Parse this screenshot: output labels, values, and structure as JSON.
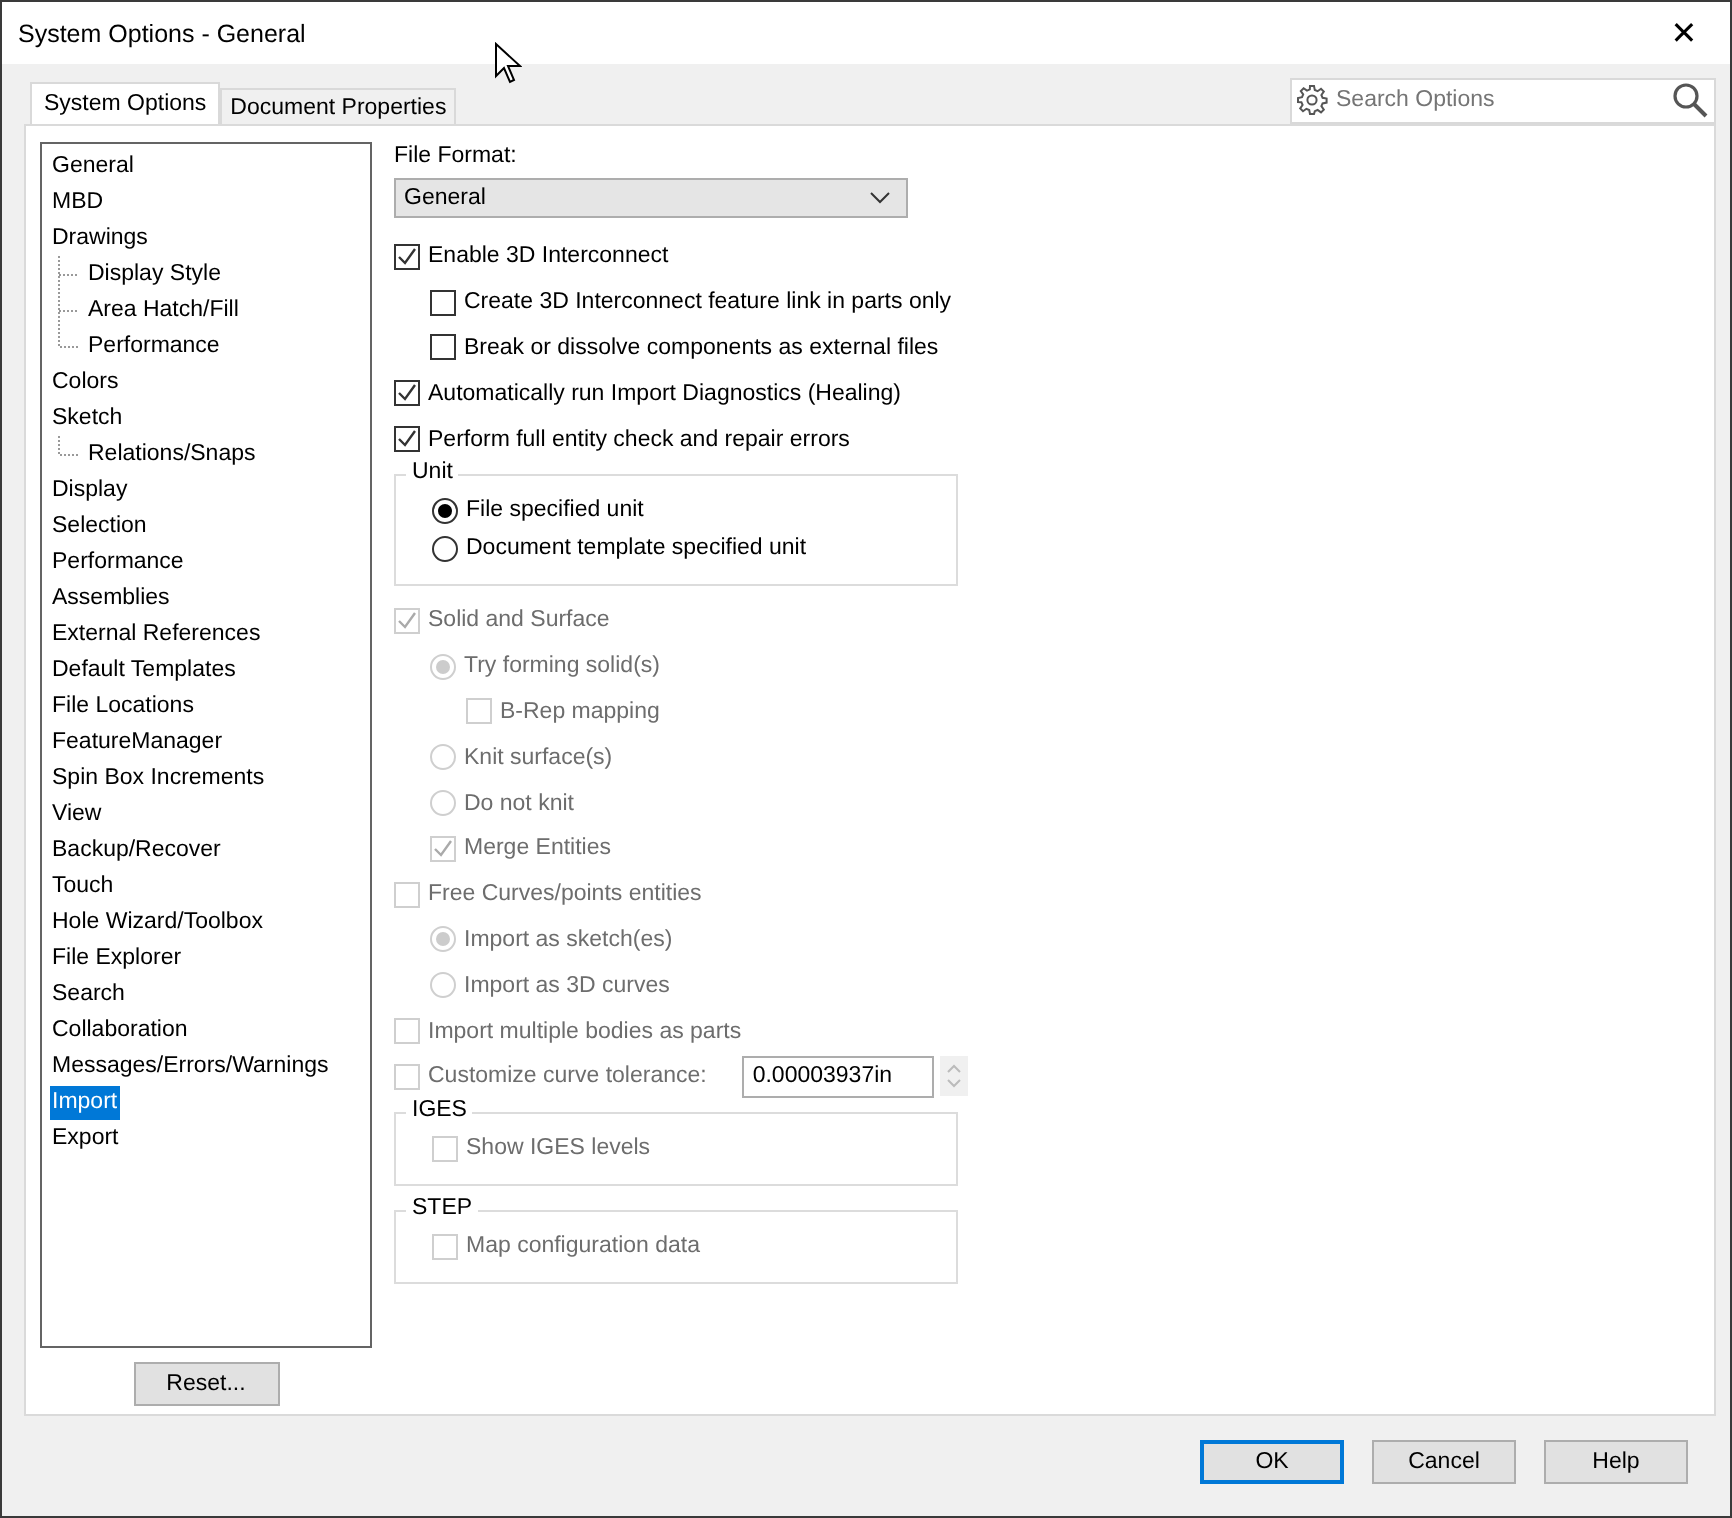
{
  "window": {
    "title": "System Options - General",
    "close": "✕"
  },
  "tabs": [
    {
      "label": "System Options",
      "selected": true
    },
    {
      "label": "Document Properties",
      "selected": false
    }
  ],
  "search": {
    "placeholder": "Search Options"
  },
  "sidebar": {
    "items": [
      {
        "label": "General",
        "selected": false
      },
      {
        "label": "MBD",
        "selected": false
      },
      {
        "label": "Drawings",
        "selected": false,
        "children": [
          {
            "label": "Display Style",
            "selected": false
          },
          {
            "label": "Area Hatch/Fill",
            "selected": false
          },
          {
            "label": "Performance",
            "selected": false
          }
        ]
      },
      {
        "label": "Colors",
        "selected": false
      },
      {
        "label": "Sketch",
        "selected": false,
        "children": [
          {
            "label": "Relations/Snaps",
            "selected": false
          }
        ]
      },
      {
        "label": "Display",
        "selected": false
      },
      {
        "label": "Selection",
        "selected": false
      },
      {
        "label": "Performance",
        "selected": false
      },
      {
        "label": "Assemblies",
        "selected": false
      },
      {
        "label": "External References",
        "selected": false
      },
      {
        "label": "Default Templates",
        "selected": false
      },
      {
        "label": "File Locations",
        "selected": false
      },
      {
        "label": "FeatureManager",
        "selected": false
      },
      {
        "label": "Spin Box Increments",
        "selected": false
      },
      {
        "label": "View",
        "selected": false
      },
      {
        "label": "Backup/Recover",
        "selected": false
      },
      {
        "label": "Touch",
        "selected": false
      },
      {
        "label": "Hole Wizard/Toolbox",
        "selected": false
      },
      {
        "label": "File Explorer",
        "selected": false
      },
      {
        "label": "Search",
        "selected": false
      },
      {
        "label": "Collaboration",
        "selected": false
      },
      {
        "label": "Messages/Errors/Warnings",
        "selected": false
      },
      {
        "label": "Import",
        "selected": true
      },
      {
        "label": "Export",
        "selected": false
      }
    ],
    "reset_button": "Reset..."
  },
  "file_format": {
    "label": "File Format:",
    "value": "General"
  },
  "options": [
    {
      "kind": "checkbox",
      "label": "Enable 3D Interconnect",
      "checked": true,
      "disabled": false,
      "children": [
        {
          "kind": "checkbox",
          "label": "Create 3D Interconnect feature link in parts only",
          "checked": false,
          "disabled": false
        },
        {
          "kind": "checkbox",
          "label": "Break or dissolve components as external files",
          "checked": false,
          "disabled": false
        }
      ]
    },
    {
      "kind": "checkbox",
      "label": "Automatically run Import Diagnostics (Healing)",
      "checked": true,
      "disabled": false
    },
    {
      "kind": "checkbox",
      "label": "Perform full entity check and repair errors",
      "checked": true,
      "disabled": false
    },
    {
      "kind": "group",
      "label": "Unit",
      "children": [
        {
          "kind": "radio",
          "label": "File specified unit",
          "selected": true,
          "disabled": false
        },
        {
          "kind": "radio",
          "label": "Document template specified unit",
          "selected": false,
          "disabled": false
        }
      ]
    },
    {
      "kind": "checkbox",
      "label": "Solid and Surface",
      "checked": true,
      "disabled": true,
      "children": [
        {
          "kind": "radio",
          "label": "Try forming solid(s)",
          "selected": true,
          "disabled": true,
          "children": [
            {
              "kind": "checkbox",
              "label": "B-Rep mapping",
              "checked": false,
              "disabled": true
            }
          ]
        },
        {
          "kind": "radio",
          "label": "Knit surface(s)",
          "selected": false,
          "disabled": true
        },
        {
          "kind": "radio",
          "label": "Do not knit",
          "selected": false,
          "disabled": true
        },
        {
          "kind": "checkbox",
          "label": "Merge Entities",
          "checked": true,
          "disabled": true
        }
      ]
    },
    {
      "kind": "checkbox",
      "label": "Free Curves/points entities",
      "checked": false,
      "disabled": true,
      "children": [
        {
          "kind": "radio",
          "label": "Import as sketch(es)",
          "selected": true,
          "disabled": true
        },
        {
          "kind": "radio",
          "label": "Import as 3D curves",
          "selected": false,
          "disabled": true
        }
      ]
    },
    {
      "kind": "checkbox",
      "label": "Import multiple bodies as parts",
      "checked": false,
      "disabled": true
    },
    {
      "kind": "tolerance",
      "label": "Customize curve tolerance:",
      "checked": false,
      "disabled": true,
      "value": "0.00003937in"
    },
    {
      "kind": "group",
      "label": "IGES",
      "children": [
        {
          "kind": "checkbox",
          "label": "Show IGES levels",
          "checked": false,
          "disabled": true
        }
      ]
    },
    {
      "kind": "group",
      "label": "STEP",
      "children": [
        {
          "kind": "checkbox",
          "label": "Map configuration data",
          "checked": false,
          "disabled": true
        }
      ]
    }
  ],
  "buttons": [
    {
      "label": "OK",
      "default": true
    },
    {
      "label": "Cancel",
      "default": false
    },
    {
      "label": "Help",
      "default": false
    }
  ]
}
